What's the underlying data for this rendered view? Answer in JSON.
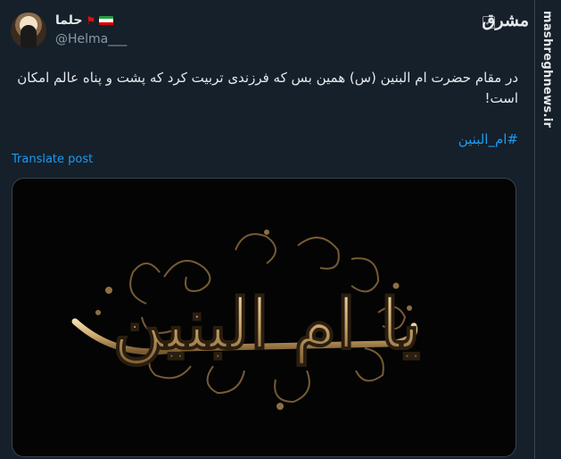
{
  "author": {
    "display_name": "حلما",
    "handle": "@Helma___"
  },
  "brand": {
    "logo_text": "مشرق",
    "watermark": "mashreghnews.ir"
  },
  "post": {
    "text": "در مقام حضرت ام البنین (س) همین بس که فرزندی تربیت کرد که پشت و پناه عالم امکان است!",
    "hashtag": "#ام_البنین",
    "translate_label": "Translate post"
  },
  "media": {
    "calligraphy_text": "یا ام البنین"
  },
  "colors": {
    "background": "#15202b",
    "accent": "#1d9bf0",
    "gold": "#c9a56a"
  }
}
